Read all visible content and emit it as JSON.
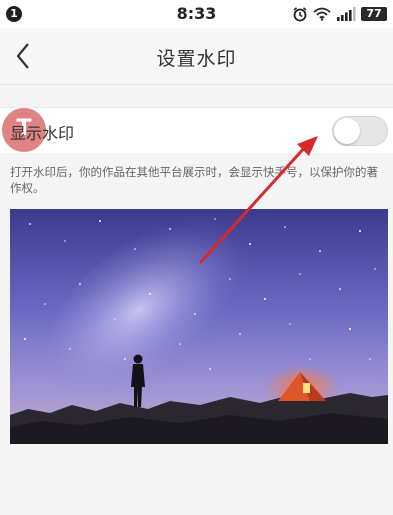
{
  "status_bar": {
    "notification_badge": "1",
    "time": "8:33",
    "icons": [
      "alarm-icon",
      "wifi-icon",
      "signal-icon"
    ],
    "battery": "77"
  },
  "header": {
    "back_icon": "chevron-left-icon",
    "title": "设置水印"
  },
  "setting": {
    "label": "显示水印",
    "toggle_on": false,
    "tap_marker_letter": "T"
  },
  "description": "打开水印后，你的作品在其他平台展示时，会显示快手号，以保护你的著作权。",
  "preview": {
    "image": "night-sky-milky-way-tent-photo"
  },
  "colors": {
    "annotation_arrow": "#d42a2a",
    "tap_marker": "#d66060",
    "toggle_off": "#e6e6e6"
  }
}
